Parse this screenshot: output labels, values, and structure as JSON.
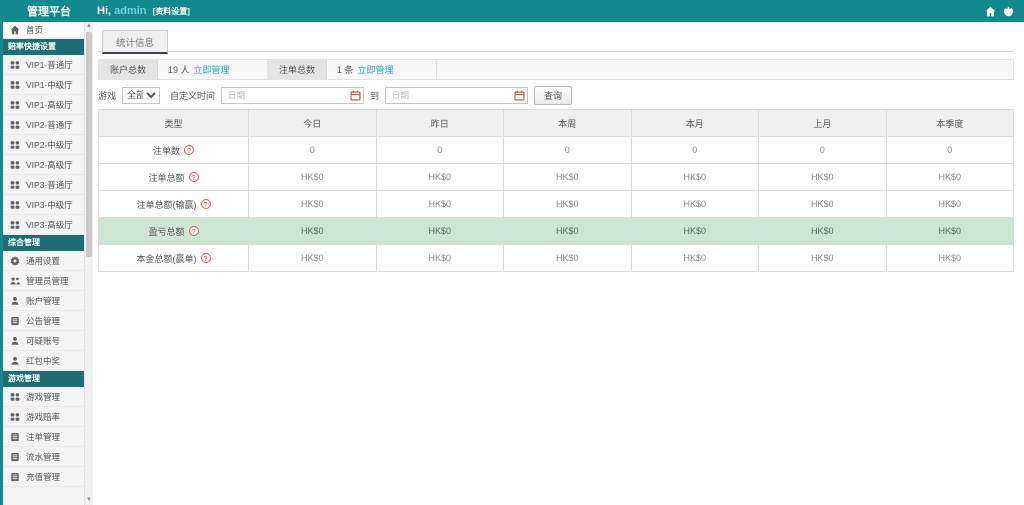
{
  "app": {
    "title": "管理平台",
    "greeting_prefix": "Hi,",
    "username": "admin",
    "profile_link": "[资料设置]"
  },
  "topbar_icons": [
    {
      "icon": "home-icon"
    },
    {
      "icon": "power-icon"
    }
  ],
  "sidebar": {
    "home": {
      "label": "首页",
      "icon": "home-icon"
    },
    "sections": [
      {
        "title": "赔率快捷设置",
        "items": [
          {
            "label": "VIP1-普通厅",
            "icon": "hall-grid-icon"
          },
          {
            "label": "VIP1-中级厅",
            "icon": "hall-grid-icon"
          },
          {
            "label": "VIP1-高级厅",
            "icon": "hall-grid-icon"
          },
          {
            "label": "VIP2-普通厅",
            "icon": "hall-grid-icon"
          },
          {
            "label": "VIP2-中级厅",
            "icon": "hall-grid-icon"
          },
          {
            "label": "VIP2-高级厅",
            "icon": "hall-grid-icon"
          },
          {
            "label": "VIP3-普通厅",
            "icon": "hall-grid-icon"
          },
          {
            "label": "VIP3-中级厅",
            "icon": "hall-grid-icon"
          },
          {
            "label": "VIP3-高级厅",
            "icon": "hall-grid-icon"
          }
        ]
      },
      {
        "title": "综合管理",
        "items": [
          {
            "label": "通用设置",
            "icon": "gear-icon"
          },
          {
            "label": "管理员管理",
            "icon": "users-icon"
          },
          {
            "label": "账户管理",
            "icon": "user-icon"
          },
          {
            "label": "公告管理",
            "icon": "document-icon"
          },
          {
            "label": "可疑账号",
            "icon": "user-icon"
          },
          {
            "label": "红包中奖",
            "icon": "user-icon"
          }
        ]
      },
      {
        "title": "游戏管理",
        "items": [
          {
            "label": "游戏管理",
            "icon": "hall-grid-icon"
          },
          {
            "label": "游戏赔率",
            "icon": "hall-grid-icon"
          },
          {
            "label": "注单管理",
            "icon": "document-icon"
          },
          {
            "label": "流水管理",
            "icon": "document-icon"
          },
          {
            "label": "充值管理",
            "icon": "document-icon"
          }
        ]
      }
    ]
  },
  "tabs": [
    {
      "label": "统计信息",
      "active": true
    }
  ],
  "stats": [
    {
      "label": "账户总数",
      "value": "19 人",
      "link": "立即管理"
    },
    {
      "label": "注单总数",
      "value": "1 条",
      "link": "立即管理"
    }
  ],
  "filter": {
    "game_label": "游戏",
    "game_value": "全部",
    "custom_time_label": "自定义时间",
    "date_placeholder": "日期",
    "to_label": "到",
    "search_button": "查询"
  },
  "table": {
    "columns": [
      "类型",
      "今日",
      "昨日",
      "本周",
      "本月",
      "上月",
      "本季度"
    ],
    "rows": [
      {
        "label": "注单数",
        "help": true,
        "highlight": false,
        "values": [
          "0",
          "0",
          "0",
          "0",
          "0",
          "0"
        ]
      },
      {
        "label": "注单总额",
        "help": true,
        "highlight": false,
        "values": [
          "HK$0",
          "HK$0",
          "HK$0",
          "HK$0",
          "HK$0",
          "HK$0"
        ]
      },
      {
        "label": "注单总额(输赢)",
        "help": true,
        "highlight": false,
        "values": [
          "HK$0",
          "HK$0",
          "HK$0",
          "HK$0",
          "HK$0",
          "HK$0"
        ]
      },
      {
        "label": "盈亏总额",
        "help": true,
        "highlight": true,
        "values": [
          "HK$0",
          "HK$0",
          "HK$0",
          "HK$0",
          "HK$0",
          "HK$0"
        ]
      },
      {
        "label": "本金总额(赢单)",
        "help": true,
        "highlight": false,
        "values": [
          "HK$0",
          "HK$0",
          "HK$0",
          "HK$0",
          "HK$0",
          "HK$0"
        ]
      }
    ]
  },
  "colors": {
    "topbar_teal": "#11898e",
    "section_teal": "#1d6f73",
    "link_teal": "#2ba7ad",
    "highlight_green": "#cfe5d3",
    "help_red": "#e05a5a",
    "calendar_icon": "#b2593f"
  }
}
